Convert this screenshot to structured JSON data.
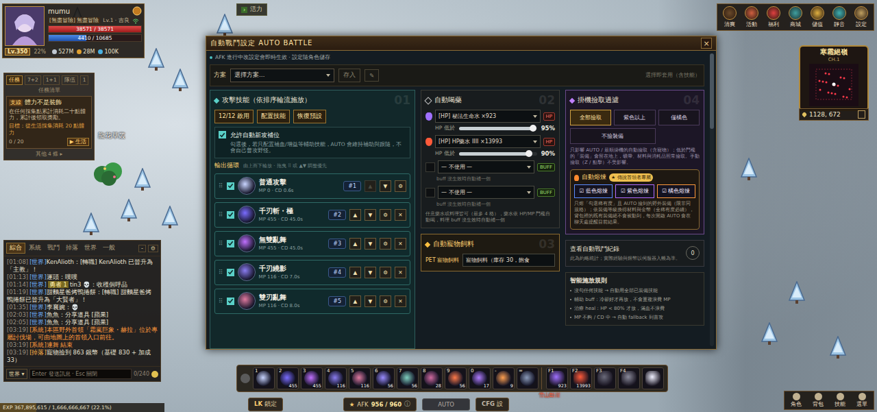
{
  "player": {
    "name": "mumu",
    "guild": "[無盡冒險] 無盡冒險",
    "rank": "Lv.1 · 吉良",
    "hp": {
      "text": "38571 / 38571",
      "level": 1
    },
    "mp": {
      "text": "4410 / 10685",
      "level": 0.41
    },
    "level": "Lv.350",
    "exp_pct": "22%",
    "currencies": [
      "527M",
      "28M",
      "100K"
    ]
  },
  "vitality_button": {
    "icon": "›",
    "label": "活力"
  },
  "quest": {
    "tabs": [
      {
        "label": "任務",
        "selected": true
      },
      {
        "label": "7+2",
        "selected": false
      },
      {
        "label": "1+1",
        "selected": false
      },
      {
        "label": "隊伍",
        "selected": false
      },
      {
        "label": "1",
        "selected": false
      }
    ],
    "list_label": "任務清單",
    "card": {
      "tag": "支線",
      "title": "體力不是裝飾",
      "desc": "在任何採集點累計消耗二十點體力，累計後領取獎勵。",
      "goal": "目標：從生活採集消耗 20 點體力",
      "progress": "0 / 20",
      "action": "▶ 生活"
    },
    "more": "其他 4 條 ▸"
  },
  "map_labels": [
    {
      "text": "龍花草叢"
    }
  ],
  "chat": {
    "tabs": [
      {
        "label": "綜合",
        "selected": true
      },
      {
        "label": "系統",
        "selected": false
      },
      {
        "label": "戰鬥",
        "selected": false
      },
      {
        "label": "掉落",
        "selected": false
      },
      {
        "label": "世界",
        "selected": false
      },
      {
        "label": "一般",
        "selected": false
      }
    ],
    "minimize": "-",
    "settings": "⚙",
    "messages": [
      {
        "time": "[01:08]",
        "channel": "[世界]",
        "color": "#6fb3ff",
        "badge": "",
        "text": "KenAlioth：[轉職] KenAlioth 已晉升為「主教」！",
        "text_color": "#e6e0d0"
      },
      {
        "time": "[01:13]",
        "channel": "[世界]",
        "color": "#6fb3ff",
        "badge": "",
        "text": "運頭：噗噗",
        "text_color": "#e6e0d0"
      },
      {
        "time": "[01:14]",
        "channel": "[世界]",
        "color": "#6fb3ff",
        "badge": "勇者 1",
        "text": "tin3 💀：收穫個呼品",
        "text_color": "#e6e0d0"
      },
      {
        "time": "[01:19]",
        "channel": "[世界]",
        "color": "#6fb3ff",
        "badge": "",
        "text": "甜麵星爸烤鴨捲餅：[轉職] 甜麵星爸烤鴨捲餅已晉升為「大賢者」！",
        "text_color": "#e6e0d0"
      },
      {
        "time": "[01:35]",
        "channel": "[世界]",
        "color": "#6fb3ff",
        "badge": "",
        "text": "李襄婉：💀",
        "text_color": "#e6e0d0"
      },
      {
        "time": "[02:03]",
        "channel": "[世界]",
        "color": "#6fb3ff",
        "badge": "",
        "text": "魚魚：分享道具 [蘋果]",
        "text_color": "#e6e0d0"
      },
      {
        "time": "[02:05]",
        "channel": "[世界]",
        "color": "#6fb3ff",
        "badge": "",
        "text": "魚魚：分享道具 [蘋果]",
        "text_color": "#e6e0d0"
      },
      {
        "time": "[03:19]",
        "channel": "[系統]",
        "color": "#ff9a3c",
        "badge": "",
        "text": "本區野外首領「霜嵐巨象・赫拉」位於專屬討伐場，可由地圖上的首領入口前往。",
        "text_color": "#ff9a3c"
      },
      {
        "time": "[03:19]",
        "channel": "[系統]",
        "color": "#ff9a3c",
        "badge": "",
        "text": "連舞 結束",
        "text_color": "#ff9a3c"
      },
      {
        "time": "[03:19]",
        "channel": "[掉落]",
        "color": "#ffb347",
        "badge": "",
        "text": "寵物撿到 863 銀幣（基礎 830 + 加成 33）",
        "text_color": "#e6e0d0"
      }
    ],
    "channel_select": "世界",
    "input_placeholder": "Enter 發送訊息 · Esc 關閉",
    "counter": "0/240"
  },
  "exp_bar": {
    "text": "EXP 367,895,615 / 1,666,666,667 (22.1%)",
    "level": 0.221
  },
  "top_menu": [
    {
      "label": "清爽"
    },
    {
      "label": "活動"
    },
    {
      "label": "福利"
    },
    {
      "label": "商城"
    },
    {
      "label": "儲值"
    },
    {
      "label": "靜音"
    },
    {
      "label": "設定"
    }
  ],
  "minimap": {
    "name": "寒霜絕嶺",
    "channel": "CH.1",
    "coords": "1128, 672"
  },
  "dialog": {
    "title": "自動戰鬥設定 AUTO BATTLE",
    "close": "×",
    "note": "AFK 進行中改設定會即時生效 · 設定隨角色儲存",
    "scheme": {
      "label": "方案",
      "select": "選擇方案…",
      "save": "存入",
      "edit": "✎",
      "hint": "選擇即套用（含技能）"
    },
    "attack": {
      "title": "攻擊技能（依排序輪流施放）",
      "number": "01",
      "buttons": [
        "12/12 啟用",
        "配置技能",
        "恢復預設"
      ],
      "fallback": {
        "checked": true,
        "label": "允許自動新攻補位",
        "desc": "勾選後，若只配置補血/增益等輔助技能，AUTO 會維持補助與跟隨，不會自己普攻野怪。"
      },
      "cycle_label": "輸出循環",
      "cycle_hint": "由上而下輪放 · 拖曳 ⠿ 或 ▲▼ 調整優先",
      "row_buttons": {
        "grip": "⠿",
        "up": "▲",
        "down": "▼",
        "gear": "⚙",
        "remove": "✕"
      },
      "skills": [
        {
          "name": "普通攻擊",
          "cost": "MP 0 · CD 0.6s",
          "order": "#1",
          "checked": true,
          "up_disabled": true,
          "removable": false,
          "color": "#c8d4ff"
        },
        {
          "name": "千刃斬・極",
          "cost": "MP 455 · CD 45.0s",
          "order": "#2",
          "checked": true,
          "up_disabled": false,
          "removable": true,
          "color": "#7a6cff"
        },
        {
          "name": "無雙亂舞",
          "cost": "MP 455 · CD 45.0s",
          "order": "#3",
          "checked": true,
          "up_disabled": false,
          "removable": true,
          "color": "#c070ff"
        },
        {
          "name": "千刃繞影",
          "cost": "MP 116 · CD 7.0s",
          "order": "#4",
          "checked": true,
          "up_disabled": false,
          "removable": true,
          "color": "#8a7cf0"
        },
        {
          "name": "雙刃亂舞",
          "cost": "MP 116 · CD 8.0s",
          "order": "#5",
          "checked": true,
          "up_disabled": false,
          "removable": true,
          "color": "#e07aa0"
        }
      ]
    },
    "potions": {
      "title": "自動喝藥",
      "number": "02",
      "slots": [
        {
          "select": "[HP] 秘法生命水 ×923",
          "tag": "HP",
          "threshold_label": "HP 低於",
          "level": 0.95,
          "reading": "95%",
          "color": "#a070ff"
        },
        {
          "select": "[HP] HP藥水 IIII ×13993",
          "tag": "HP",
          "threshold_label": "HP 低於",
          "level": 0.9,
          "reading": "90%",
          "color": "#ff5a3a"
        }
      ],
      "buffs": [
        {
          "select": "— 不使用 —",
          "tag": "BUFF",
          "checked": false,
          "hint": "buff 沒生效時自動補一個"
        },
        {
          "select": "— 不使用 —",
          "tag": "BUFF",
          "checked": false,
          "hint": "buff 沒生效時自動補一個"
        }
      ],
      "footer": "任意藥水或料理皆可（最多 4 格），藥水依 HP/MP 門檻自動喝，料理 buff 沒生效時自動補一個"
    },
    "pet": {
      "title": "自動寵物飼料",
      "number": "03",
      "label": "PET 寵物飼料",
      "select": "寵物飼料（庫存 30，飽食"
    },
    "loot": {
      "title": "掛機撿取過濾",
      "number": "04",
      "options": [
        {
          "label": "全部撿取",
          "selected": true
        },
        {
          "label": "紫色以上",
          "selected": false
        },
        {
          "label": "僅橘色",
          "selected": false
        },
        {
          "label": "不撿裝備",
          "selected": false
        }
      ],
      "desc": "只影響 AUTO / 最順掛機的自動撿取（含寵物）；低於門檻的「裝備」會留在地上，礦帶、材料與消耗品照常撿取。手動撿取（Z / 點擊）不受影響。",
      "smelt": {
        "title": "自動熔煉",
        "badge": "★ 傳說首領者專屬",
        "options": [
          {
            "label": "☑ 藍色熔煉",
            "checked": true,
            "color": "#5a8cff"
          },
          {
            "label": "☑ 紫色熔煉",
            "checked": true,
            "color": "#b06cff"
          },
          {
            "label": "☑ 橘色熔煉",
            "checked": true,
            "color": "#ff9a3c"
          }
        ],
        "desc": "只熔「勾選稀有度」且 AUTO 撿到的野外裝備（限非同規格）；依裝備等級換得材料與金幣（全稀有度必續），背包裡的既有裝備絕不會被動到，每次開啟 AUTO 會在聊天處提醒目前結果。"
      }
    },
    "record": {
      "title": "查看自動戰鬥紀錄",
      "desc": "此為約略統計；實際經驗與銀幣以伺服器入帳為準。",
      "count": "0"
    },
    "rules": {
      "title": "智能施放規則",
      "items": [
        "沒勾任何技能 → 自動用全部已裝備技能",
        "輔助 buff：冷卻好才再放，不會重複浪費 MP",
        "治療 heal：HP < 80% 才放，滿血不浪費",
        "MP 不夠 / CD 中 → 自動 fallback 到普攻"
      ]
    }
  },
  "hotbar": {
    "skills": [
      {
        "key": "1",
        "count": "",
        "color": "#c8d4ff"
      },
      {
        "key": "2",
        "count": "455",
        "color": "#7a6cff"
      },
      {
        "key": "3",
        "count": "455",
        "color": "#c070ff"
      },
      {
        "key": "4",
        "count": "116",
        "color": "#8a7cf0"
      },
      {
        "key": "5",
        "count": "116",
        "color": "#e07aa0"
      },
      {
        "key": "6",
        "count": "56",
        "color": "#9a8cff"
      },
      {
        "key": "7",
        "count": "56",
        "color": "#7fd0c0"
      },
      {
        "key": "8",
        "count": "28",
        "color": "#d06aa0"
      },
      {
        "key": "9",
        "count": "56",
        "color": "#ff7a4a"
      },
      {
        "key": "0",
        "count": "17",
        "color": "#b07cff"
      },
      {
        "key": "-",
        "count": "9",
        "color": "#ffa050"
      },
      {
        "key": "=",
        "count": "",
        "color": "#8a9ab8"
      }
    ],
    "items": [
      {
        "key": "F1",
        "count": "923",
        "color": "#a070ff"
      },
      {
        "key": "F2",
        "count": "13993",
        "color": "#ff5a3a"
      },
      {
        "key": "F3",
        "count": "",
        "color": "#6a6a7a"
      },
      {
        "key": "F4",
        "count": "",
        "color": "#8a8a9a"
      },
      {
        "key": "",
        "count": "",
        "color": "#f0f0ff"
      }
    ],
    "zone_label": "雪山斷崖"
  },
  "bottom_bar": {
    "lock": {
      "key": "LK",
      "label": "鎖定"
    },
    "afk": {
      "star": "★",
      "label": "AFK",
      "value": "956 / 960",
      "info": "ⓘ"
    },
    "auto": "AUTO",
    "cfg": {
      "key": "CFG",
      "label": "設"
    }
  },
  "bottom_menu": [
    {
      "label": "角色"
    },
    {
      "label": "背包"
    },
    {
      "label": "技能"
    },
    {
      "label": "選單"
    }
  ]
}
